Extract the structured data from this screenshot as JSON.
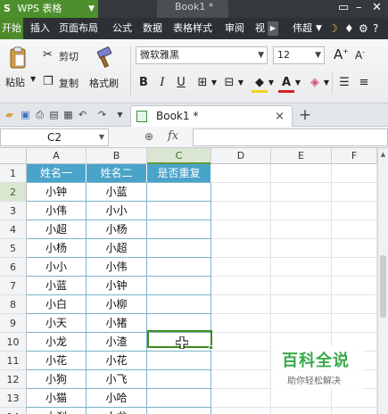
{
  "titlebar": {
    "app_name": "WPS 表格",
    "app_logo": "S",
    "document_tab": "Book1 *",
    "colors": {
      "bar": "#35393d",
      "app_tab": "#4c8f2c"
    }
  },
  "menubar": {
    "items": [
      "开始",
      "插入",
      "页面布局",
      "公式",
      "数据",
      "表格样式",
      "审阅",
      "视"
    ],
    "active": "开始",
    "user": "伟超"
  },
  "ribbon": {
    "paste": "粘贴",
    "cut": "剪切",
    "copy": "复制",
    "format_painter": "格式刷",
    "font_name": "微软雅黑",
    "font_size": "12",
    "bold": "B",
    "italic": "I",
    "underline": "U",
    "grow_font": "A",
    "shrink_font": "A"
  },
  "tabbar": {
    "doc_name": "Book1 *",
    "close": "×",
    "new_tab": "+"
  },
  "formulabar": {
    "cell_ref": "C2",
    "fx": "fx",
    "formula": ""
  },
  "grid": {
    "columns": [
      "A",
      "B",
      "C",
      "D",
      "E",
      "F"
    ],
    "selected_column": "C",
    "selected_row": "2",
    "row_numbers": [
      "1",
      "2",
      "3",
      "4",
      "5",
      "6",
      "7",
      "8",
      "9",
      "10",
      "11",
      "12",
      "13",
      "14"
    ],
    "header": [
      "姓名一",
      "姓名二",
      "是否重复"
    ],
    "rows": [
      [
        "小钟",
        "小蓝",
        ""
      ],
      [
        "小伟",
        "小小",
        ""
      ],
      [
        "小超",
        "小杨",
        ""
      ],
      [
        "小杨",
        "小超",
        ""
      ],
      [
        "小小",
        "小伟",
        ""
      ],
      [
        "小蓝",
        "小钟",
        ""
      ],
      [
        "小白",
        "小柳",
        ""
      ],
      [
        "小天",
        "小猪",
        ""
      ],
      [
        "小龙",
        "小渣",
        ""
      ],
      [
        "小花",
        "小花",
        ""
      ],
      [
        "小狗",
        "小飞",
        ""
      ],
      [
        "小猫",
        "小哈",
        ""
      ],
      [
        "小刹",
        "小龙",
        ""
      ]
    ],
    "colors": {
      "header_bg": "#4aa3c9",
      "header_text": "#ffffff",
      "selection": "#3d8d22"
    }
  },
  "watermark": {
    "title": "百科全说",
    "subtitle": "助你轻松解决"
  }
}
